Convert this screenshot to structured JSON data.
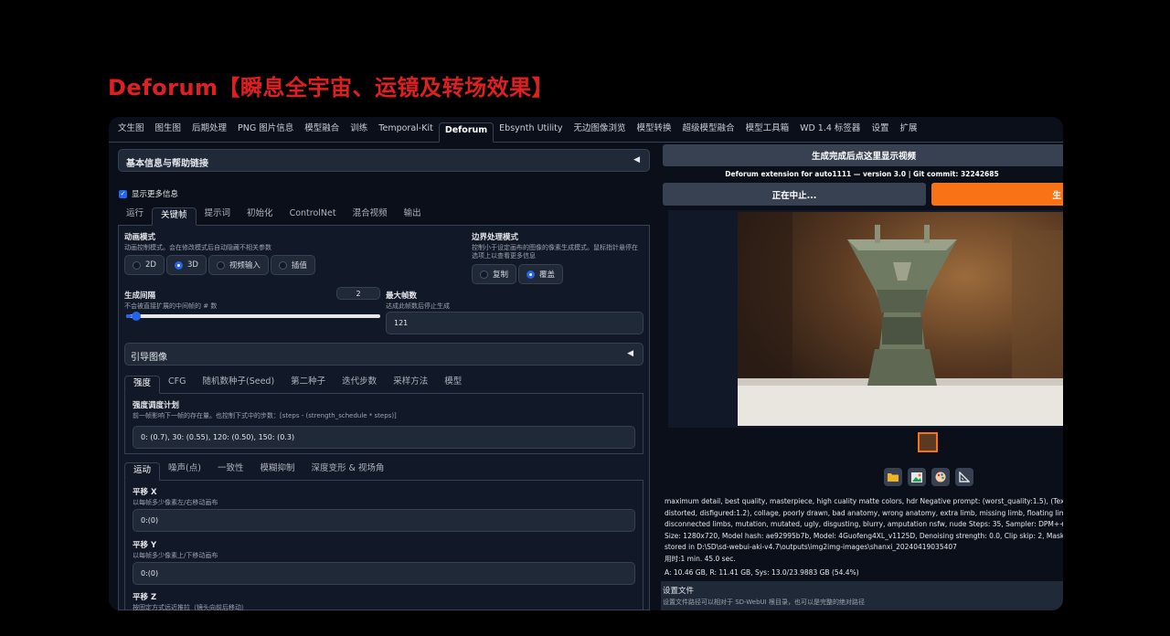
{
  "slide_title": "Deforum【瞬息全宇宙、运镜及转场效果】",
  "top_tabs": [
    "文生图",
    "图生图",
    "后期处理",
    "PNG 图片信息",
    "模型融合",
    "训练",
    "Temporal-Kit",
    "Deforum",
    "Ebsynth Utility",
    "无边图像浏览",
    "模型转换",
    "超级模型融合",
    "模型工具箱",
    "WD 1.4 标签器",
    "设置",
    "扩展"
  ],
  "active_top_tab": "Deforum",
  "left": {
    "info_accordion": "基本信息与帮助链接",
    "show_more_checkbox": "显示更多信息",
    "sub_tabs": [
      "运行",
      "关键帧",
      "提示词",
      "初始化",
      "ControlNet",
      "混合视频",
      "输出"
    ],
    "animation_mode": {
      "label": "动画模式",
      "desc": "动画控制模式。会在修改模式后自动隐藏不相关参数",
      "options": [
        "2D",
        "3D",
        "视频输入",
        "插值"
      ],
      "selected": "3D"
    },
    "border_mode": {
      "label": "边界处理模式",
      "desc1": "控制小于设定画布的图像的像素生成模式。鼠标指针悬停在",
      "desc2": "选项上以查看更多信息",
      "options": [
        "复制",
        "覆盖"
      ],
      "selected": "覆盖"
    },
    "cadence": {
      "label": "生成间隔",
      "desc": "不会被直接扩展的中间帧的 # 数",
      "value": "2",
      "slider_fraction": 0.02
    },
    "max_frames": {
      "label": "最大帧数",
      "desc": "达成此帧数后停止生成",
      "value": "121"
    },
    "guided_images_accordion": "引导图像",
    "param_tabs": [
      "强度",
      "CFG",
      "随机数种子(Seed)",
      "第二种子",
      "迭代步数",
      "采样方法",
      "模型"
    ],
    "strength": {
      "label": "强度调度计划",
      "desc": "前一帧影响下一帧的存在量。也控制下式中的步数：[steps - (strength_schedule * steps)]",
      "value": "0: (0.7), 30: (0.55), 120: (0.50), 150: (0.3)"
    },
    "motion_tabs": [
      "运动",
      "噪声(点)",
      "一致性",
      "模糊抑制",
      "深度变形 & 视场角"
    ],
    "translation_x": {
      "label": "平移 X",
      "desc": "以每帧多少像素左/右移动画布",
      "value": "0:(0)"
    },
    "translation_y": {
      "label": "平移 Y",
      "desc": "以每帧多少像素上/下移动画布",
      "value": "0:(0)"
    },
    "translation_z": {
      "label": "平移 Z",
      "desc": "按固定方式远近推拉（镜头向前后移动）"
    }
  },
  "right": {
    "generate_button": "生成完成后点这里显示视频",
    "version_line": "Deforum extension for auto1111 — version 3.0 | Git commit: 32242685",
    "stop_button": "正在中止...",
    "generate_short": "生",
    "info_text": [
      "maximum detail, best quality, masterpiece, high cuality matte colors, hdr Negative prompt: (worst_quality:1.5), (Text:1.35), (w",
      "distorted, disfigured:1.2), collage, poorly drawn, bad anatomy, wrong anatomy, extra limb, missing limb, floating limbs, (muta",
      "disconnected limbs, mutation, mutated, ugly, disgusting, blurry, amputation nsfw, nude Steps: 35, Sampler: DPM++ SDE Karr",
      "Size: 1280x720, Model hash: ae92995b7b, Model: 4Guofeng4XL_v1125D, Denoising strength: 0.0, Clip skip: 2, Mask blur: 4, Eta:",
      "stored in D:\\SD\\sd-webui-aki-v4.7\\outputs\\img2img-images\\shanxi_20240419035407"
    ],
    "time_taken": "用时:1 min. 45.0 sec.",
    "memory": "A: 10.46 GB, R: 11.41 GB, Sys: 13.0/23.9883 GB (54.4%)",
    "settings_title": "设置文件",
    "settings_desc": "设置文件路径可以相对于 SD-WebUI 根目录，也可以是完整的绝对路径",
    "icons": [
      "folder-icon",
      "image-icon",
      "palette-icon",
      "ruler-icon"
    ]
  },
  "colors": {
    "accent_orange": "#f97316",
    "accent_blue": "#2563eb",
    "title_red": "#e02020",
    "panel_bg": "#1f2937"
  }
}
